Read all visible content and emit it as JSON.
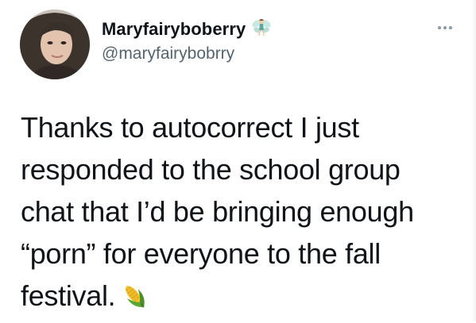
{
  "user": {
    "display_name": "Maryfairyboberry",
    "handle": "@maryfairybobrry",
    "name_emoji_icon": "fairy-emoji-icon",
    "avatar_icon": "profile-photo"
  },
  "actions": {
    "more_icon": "more-horizontal-icon"
  },
  "tweet": {
    "lines": [
      "Thanks to autocorrect I just",
      "responded to the school group",
      "chat that I’d be bringing enough",
      "“porn” for everyone to the fall",
      "festival."
    ],
    "trailing_emoji_icon": "corn-emoji-icon"
  },
  "colors": {
    "text": "#0f1419",
    "secondary_text": "#536471"
  }
}
